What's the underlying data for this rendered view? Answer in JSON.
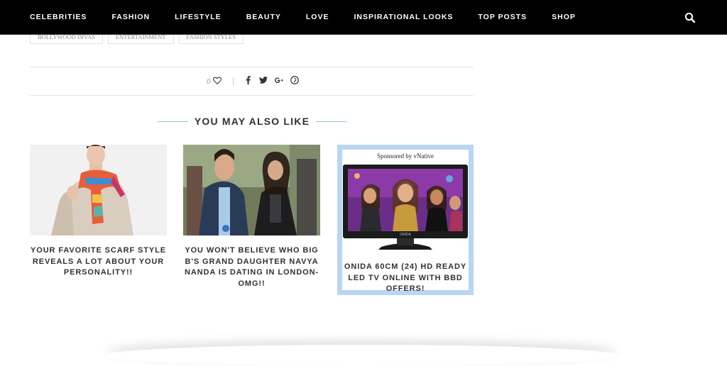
{
  "nav": {
    "items": [
      {
        "label": "CELEBRITIES"
      },
      {
        "label": "FASHION"
      },
      {
        "label": "LIFESTYLE"
      },
      {
        "label": "BEAUTY"
      },
      {
        "label": "LOVE"
      },
      {
        "label": "INSPIRATIONAL LOOKS"
      },
      {
        "label": "TOP POSTS"
      },
      {
        "label": "SHOP"
      }
    ],
    "search_icon": "search-icon"
  },
  "tags": [
    "BOLLYWOOD DIVAS",
    "ENTERTAINMENT",
    "FASHION STYLES"
  ],
  "share": {
    "like_count": "0",
    "icons": [
      "facebook-icon",
      "twitter-icon",
      "google-plus-icon",
      "pinterest-icon"
    ]
  },
  "related": {
    "heading": "YOU MAY ALSO LIKE",
    "accent_color": "#8fcac4",
    "cards": [
      {
        "title": "YOUR FAVORITE SCARF STYLE REVEALS A LOT ABOUT YOUR PERSONALITY!!"
      },
      {
        "title": "YOU WON'T BELIEVE WHO BIG B'S GRAND DAUGHTER NAVYA NANDA IS DATING IN LONDON- OMG!!"
      }
    ],
    "sponsored": {
      "label": "Sponsored by vNative",
      "title": "ONIDA 60CM (24) HD READY LED TV ONLINE WITH BBD OFFERS!",
      "brand_on_tv": "ONIDA",
      "frame_color": "#b8d6f3"
    }
  }
}
